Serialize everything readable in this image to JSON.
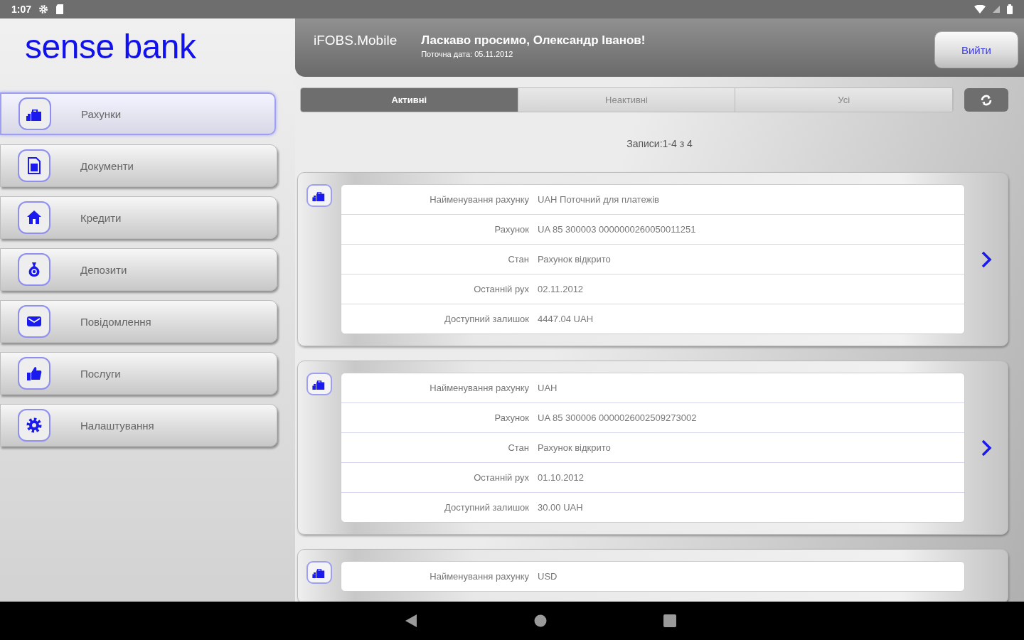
{
  "status_bar": {
    "time": "1:07"
  },
  "logo": "sense bank",
  "header": {
    "app_name": "iFOBS.Mobile",
    "greeting": "Ласкаво просимо, Олександр Іванов!",
    "date": "Поточна дата: 05.11.2012",
    "logout": "Вийти"
  },
  "sidebar": {
    "items": [
      {
        "label": "Рахунки",
        "kind": "accounts",
        "selected": true
      },
      {
        "label": "Документи",
        "kind": "document",
        "selected": false
      },
      {
        "label": "Кредити",
        "kind": "house",
        "selected": false
      },
      {
        "label": "Депозити",
        "kind": "moneybag",
        "selected": false
      },
      {
        "label": "Повідомлення",
        "kind": "mail",
        "selected": false
      },
      {
        "label": "Послуги",
        "kind": "thumb",
        "selected": false
      },
      {
        "label": "Налаштування",
        "kind": "gear",
        "selected": false
      }
    ]
  },
  "tabs": [
    {
      "label": "Активні",
      "selected": true
    },
    {
      "label": "Неактивні",
      "selected": false
    },
    {
      "label": "Усі",
      "selected": false
    }
  ],
  "records": "Записи:1-4 з 4",
  "accounts": [
    {
      "rows": [
        {
          "label": "Найменування рахунку",
          "value": "UAH Поточний для платежів"
        },
        {
          "label": "Рахунок",
          "value": "UA 85 300003 0000000260050011251"
        },
        {
          "label": "Стан",
          "value": "Рахунок відкрито"
        },
        {
          "label": "Останній рух",
          "value": "02.11.2012"
        },
        {
          "label": "Доступний залишок",
          "value": "4447.04 UAH"
        }
      ]
    },
    {
      "rows": [
        {
          "label": "Найменування рахунку",
          "value": "UAH"
        },
        {
          "label": "Рахунок",
          "value": "UA 85 300006 0000026002509273002"
        },
        {
          "label": "Стан",
          "value": "Рахунок відкрито"
        },
        {
          "label": "Останній рух",
          "value": "01.10.2012"
        },
        {
          "label": "Доступний залишок",
          "value": "30.00 UAH"
        }
      ]
    },
    {
      "rows": [
        {
          "label": "Найменування рахунку",
          "value": "USD"
        }
      ]
    }
  ]
}
